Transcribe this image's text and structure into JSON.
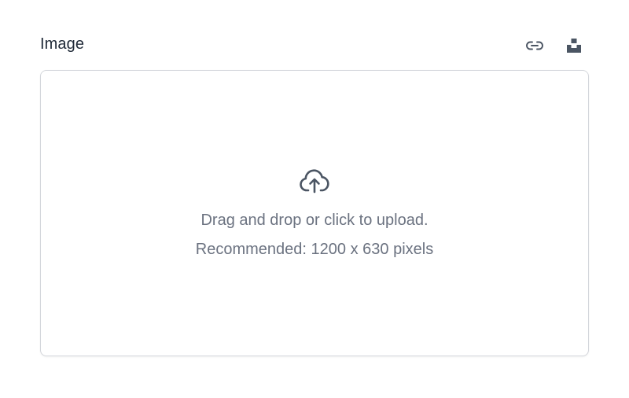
{
  "field": {
    "label": "Image",
    "actions": [
      {
        "name": "link",
        "icon": "link-icon"
      },
      {
        "name": "unsplash",
        "icon": "unsplash-icon"
      }
    ]
  },
  "dropzone": {
    "icon": "cloud-upload-icon",
    "primary_text": "Drag and drop or click to upload.",
    "secondary_text": "Recommended: 1200 x 630 pixels"
  },
  "colors": {
    "label": "#1f2937",
    "muted_text": "#6b7280",
    "icon": "#4b5563",
    "border": "#d4d7dc"
  }
}
